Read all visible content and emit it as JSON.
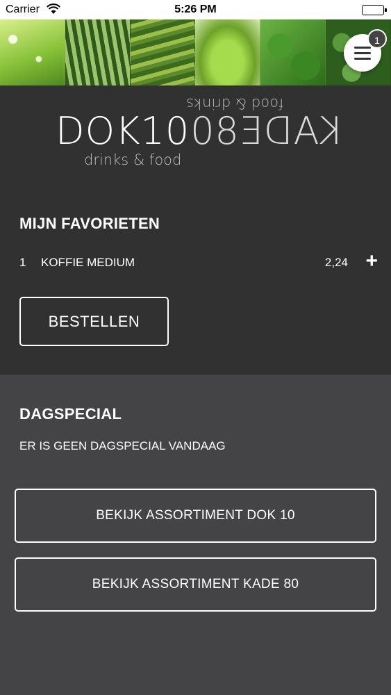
{
  "status_bar": {
    "carrier": "Carrier",
    "time": "5:26 PM"
  },
  "header": {
    "cart_count": "1",
    "banner_images": [
      "chamomile",
      "watermelons",
      "rice-terraces",
      "green-smoothie",
      "basil",
      "broccoli"
    ]
  },
  "logo": {
    "left_word": "DOK10",
    "right_word": "KADE80",
    "tagline": "drinks & food",
    "tagline_mirrored": "food & drinks"
  },
  "favorites": {
    "title": "MIJN FAVORIETEN",
    "items": [
      {
        "qty": "1",
        "name": "KOFFIE MEDIUM",
        "price": "2,24"
      }
    ],
    "add_symbol": "+",
    "order_button": "BESTELLEN"
  },
  "daily_special": {
    "title": "DAGSPECIAL",
    "message": "ER IS GEEN DAGSPECIAL VANDAAG"
  },
  "actions": {
    "view_dok10": "BEKIJK ASSORTIMENT DOK 10",
    "view_kade80": "BEKIJK ASSORTIMENT KADE 80"
  },
  "colors": {
    "top_background": "#323132",
    "bottom_background": "#444345",
    "text": "#ffffff"
  }
}
